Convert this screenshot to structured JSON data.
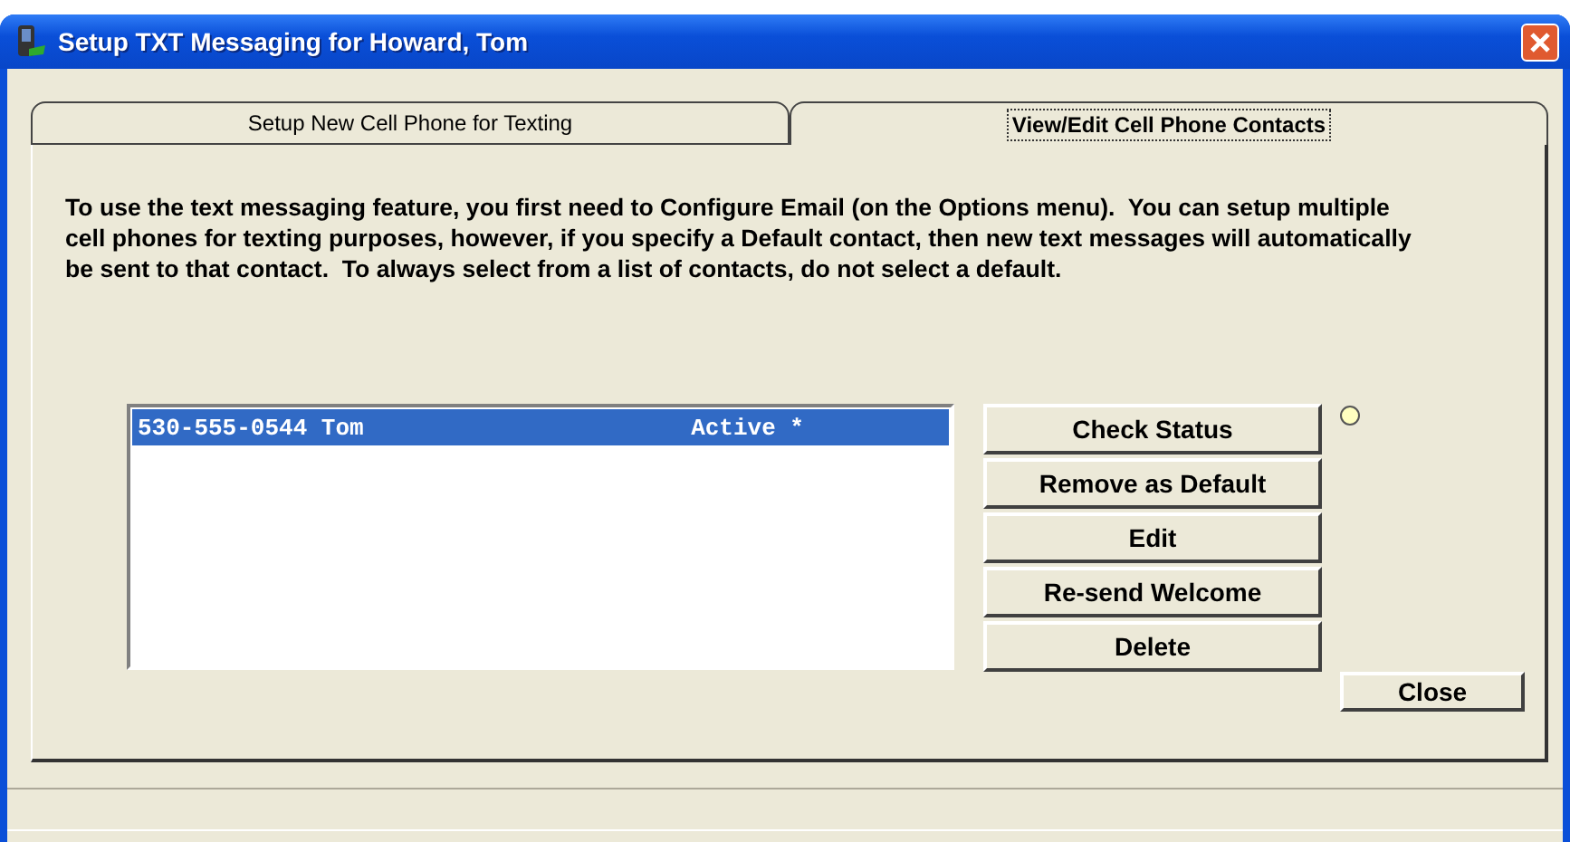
{
  "window": {
    "title": "Setup TXT Messaging for Howard, Tom"
  },
  "tabs": [
    {
      "label": "Setup New Cell Phone for Texting",
      "selected": false
    },
    {
      "label": "View/Edit Cell Phone Contacts",
      "selected": true
    }
  ],
  "instructions": "To use the text messaging feature, you first need to Configure Email (on the Options menu).  You can setup multiple cell phones for texting purposes, however, if you specify a Default contact, then new text messages will automatically be sent to that contact.  To always select from a list of contacts, do not select a default.",
  "contacts": [
    {
      "phone_and_name": "530-555-0544 Tom",
      "status": "Active *",
      "selected": true
    }
  ],
  "actions": [
    "Check Status",
    "Remove as Default",
    "Edit",
    "Re-send Welcome",
    "Delete"
  ],
  "status_indicator": {
    "color": "#ffffc0"
  },
  "close_button": "Close"
}
